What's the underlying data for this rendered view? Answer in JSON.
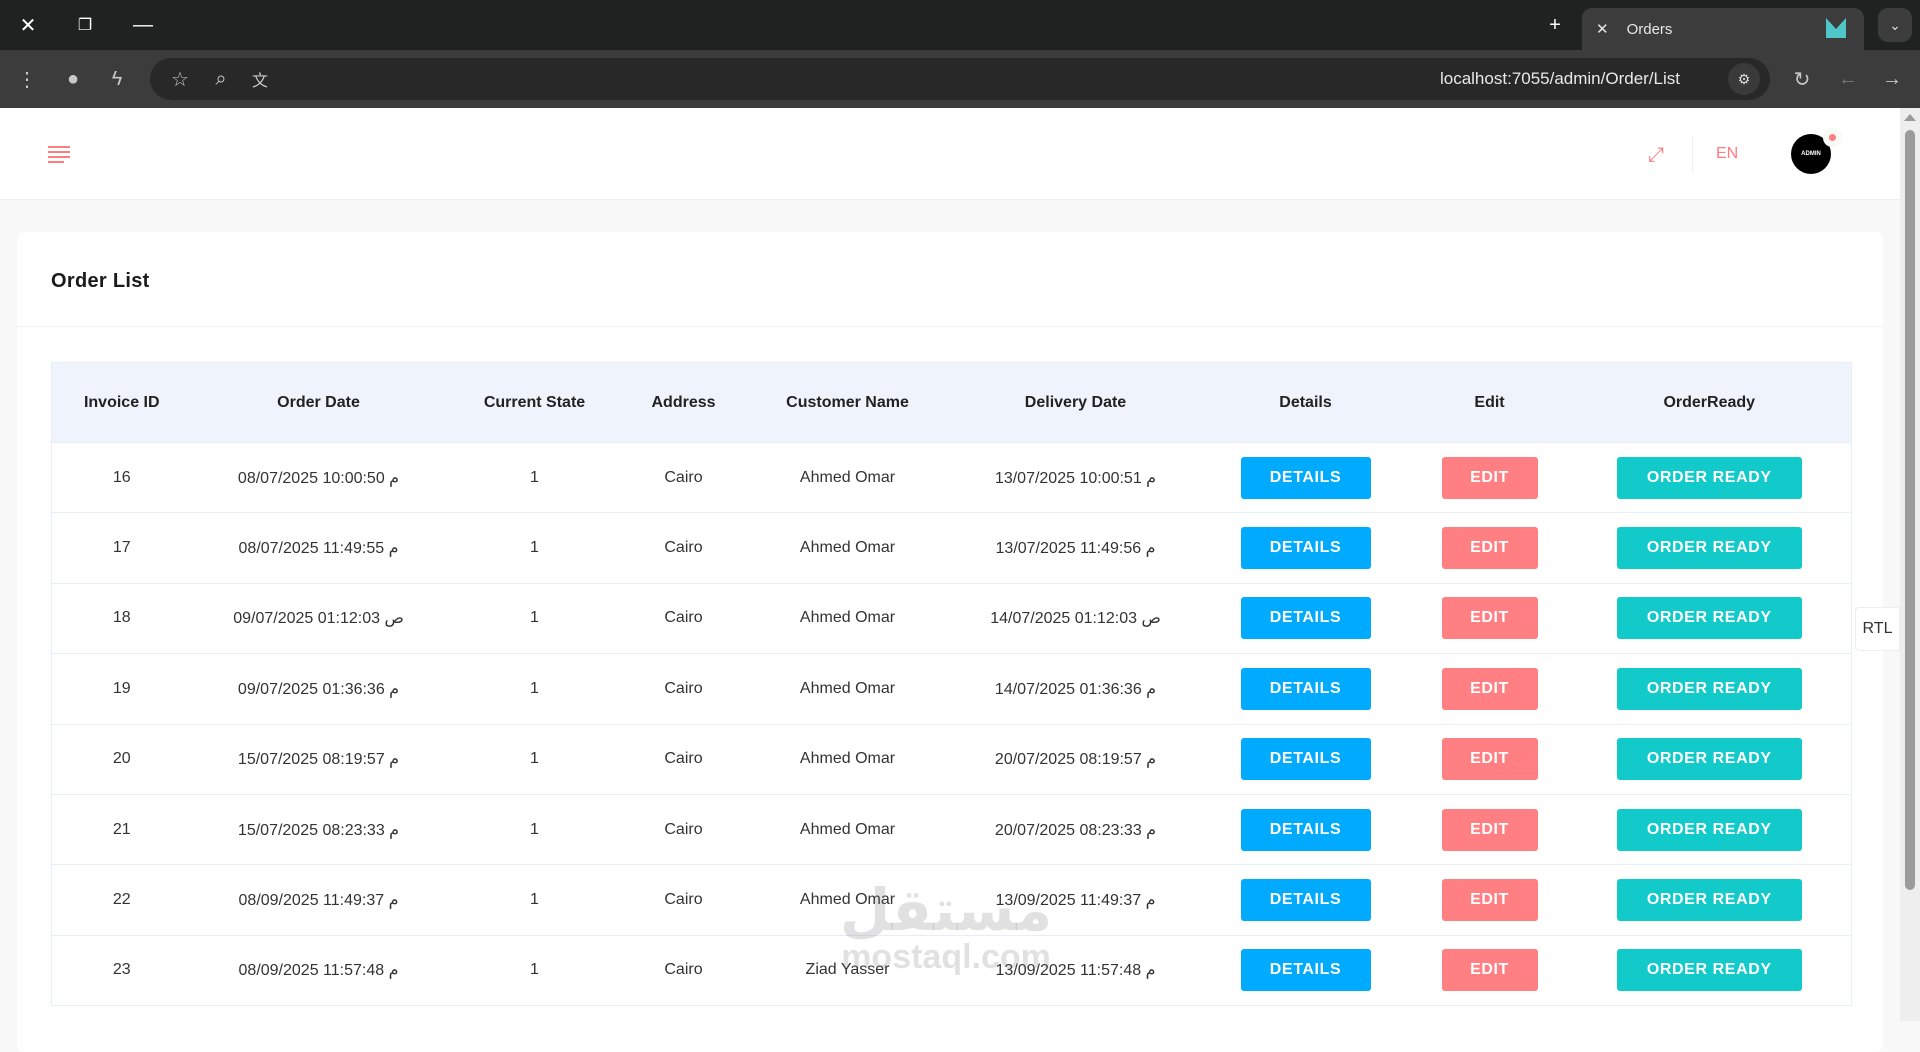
{
  "browser": {
    "tab_title": "Orders",
    "url": "localhost:7055/admin/Order/List"
  },
  "header": {
    "language": "EN",
    "avatar_text": "ADMIN"
  },
  "card": {
    "title": "Order List"
  },
  "table": {
    "columns": [
      "Invoice ID",
      "Order Date",
      "Current State",
      "Address",
      "Customer Name",
      "Delivery Date",
      "Details",
      "Edit",
      "OrderReady"
    ],
    "rows": [
      {
        "id": "16",
        "order_date": "08/07/2025 10:00:50 م",
        "state": "1",
        "address": "Cairo",
        "customer": "Ahmed Omar",
        "delivery_date": "13/07/2025 10:00:51 م"
      },
      {
        "id": "17",
        "order_date": "08/07/2025 11:49:55 م",
        "state": "1",
        "address": "Cairo",
        "customer": "Ahmed Omar",
        "delivery_date": "13/07/2025 11:49:56 م"
      },
      {
        "id": "18",
        "order_date": "09/07/2025 01:12:03 ص",
        "state": "1",
        "address": "Cairo",
        "customer": "Ahmed Omar",
        "delivery_date": "14/07/2025 01:12:03 ص"
      },
      {
        "id": "19",
        "order_date": "09/07/2025 01:36:36 م",
        "state": "1",
        "address": "Cairo",
        "customer": "Ahmed Omar",
        "delivery_date": "14/07/2025 01:36:36 م"
      },
      {
        "id": "20",
        "order_date": "15/07/2025 08:19:57 م",
        "state": "1",
        "address": "Cairo",
        "customer": "Ahmed Omar",
        "delivery_date": "20/07/2025 08:19:57 م"
      },
      {
        "id": "21",
        "order_date": "15/07/2025 08:23:33 م",
        "state": "1",
        "address": "Cairo",
        "customer": "Ahmed Omar",
        "delivery_date": "20/07/2025 08:23:33 م"
      },
      {
        "id": "22",
        "order_date": "08/09/2025 11:49:37 م",
        "state": "1",
        "address": "Cairo",
        "customer": "Ahmed Omar",
        "delivery_date": "13/09/2025 11:49:37 م"
      },
      {
        "id": "23",
        "order_date": "08/09/2025 11:57:48 م",
        "state": "1",
        "address": "Cairo",
        "customer": "Ziad Yasser",
        "delivery_date": "13/09/2025 11:57:48 م"
      }
    ],
    "buttons": {
      "details": "DETAILS",
      "edit": "EDIT",
      "ready": "ORDER READY"
    }
  },
  "rtl_toggle": "RTL",
  "watermark": {
    "arabic": "مستقل",
    "latin": "mostaql.com"
  },
  "colors": {
    "details": "#00aaff",
    "edit": "#ff7f82",
    "ready": "#12caca",
    "accent": "#ff7c80"
  }
}
